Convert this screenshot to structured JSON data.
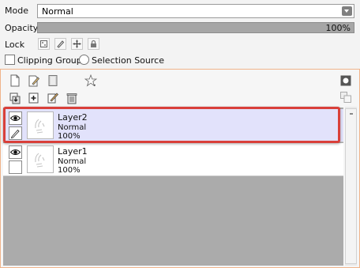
{
  "mode": {
    "label": "Mode",
    "value": "Normal"
  },
  "opacity": {
    "label": "Opacity",
    "value": "100%",
    "fraction": 1.0
  },
  "lock": {
    "label": "Lock",
    "buttons": [
      "lock-transparent-icon",
      "lock-paint-icon",
      "lock-move-icon",
      "lock-all-icon"
    ]
  },
  "options": {
    "clipping_group": "Clipping Group",
    "selection_source": "Selection Source"
  },
  "toolbar": {
    "row1": [
      "new-raster-layer-icon",
      "new-vector-layer-icon",
      "new-folder-icon",
      "layer-properties-icon"
    ],
    "row2": [
      "merge-down-icon",
      "new-layer-icon",
      "copy-layer-icon",
      "delete-layer-icon"
    ],
    "right": [
      "layer-mask-icon",
      "layer-collapse-icon"
    ]
  },
  "layers": [
    {
      "name": "Layer2",
      "blend": "Normal",
      "opacity": "100%",
      "visible": true,
      "selected": true,
      "editing": true
    },
    {
      "name": "Layer1",
      "blend": "Normal",
      "opacity": "100%",
      "visible": true,
      "selected": false,
      "editing": false
    }
  ],
  "colors": {
    "highlight": "#d9403a",
    "selected_row": "#e2e2fb",
    "panel_border": "#f0b48a"
  }
}
